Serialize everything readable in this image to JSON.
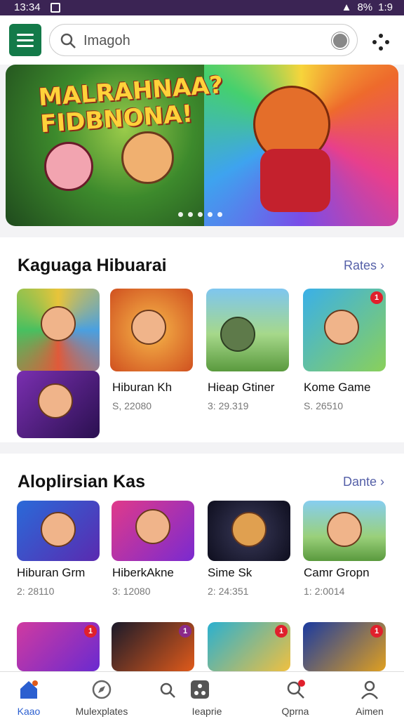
{
  "status": {
    "time": "13:34",
    "battery": "8%",
    "right_time": "1:9"
  },
  "search": {
    "placeholder": "Imagoh"
  },
  "banner": {
    "title": "MALRAHNAA? FIDBNONA!"
  },
  "section1": {
    "title": "Kaguaga Hibuarai",
    "more": "Rates",
    "items": [
      {
        "name": "",
        "sub": ""
      },
      {
        "name": "Hiburan Kh",
        "sub": "S, 22080"
      },
      {
        "name": "Hieap Gtiner",
        "sub": "3: 29.319"
      },
      {
        "name": "Kome Game",
        "sub": "S. 26510"
      }
    ]
  },
  "section2": {
    "title": "Aloplirsian Kas",
    "more": "Dante",
    "items": [
      {
        "name": "Hiburan Grm",
        "sub": "2: 28110"
      },
      {
        "name": "HiberkAkne",
        "sub": "3: 12080"
      },
      {
        "name": "Sime Sk",
        "sub": "2: 24:351"
      },
      {
        "name": "Camr Gropn",
        "sub": "1: 2:0014"
      }
    ]
  },
  "nav": [
    {
      "label": "Kaao"
    },
    {
      "label": "Mulexplates"
    },
    {
      "label": "Ieaprie"
    },
    {
      "label": "Qprna"
    },
    {
      "label": "Aimen"
    }
  ],
  "colors": {
    "accent": "#137a49",
    "status_bar": "#3b2454",
    "link": "#5560a8",
    "active_nav": "#2b5fd0"
  }
}
